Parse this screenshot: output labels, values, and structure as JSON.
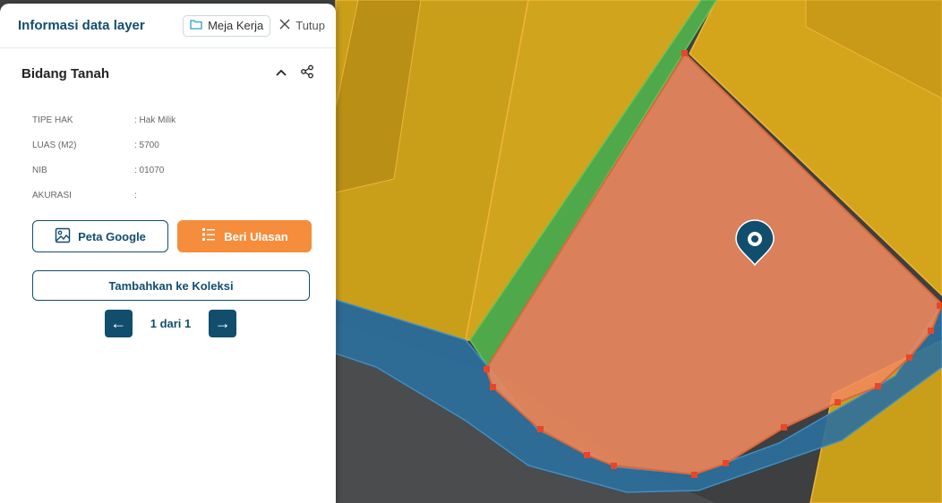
{
  "panel": {
    "title": "Informasi data layer",
    "workspace_label": "Meja Kerja",
    "close_label": "Tutup"
  },
  "section": {
    "title": "Bidang Tanah"
  },
  "attributes": [
    {
      "key": "TIPE HAK",
      "value": ": Hak Milik"
    },
    {
      "key": "LUAS (M2)",
      "value": ": 5700"
    },
    {
      "key": "NIB",
      "value": ": 01070"
    },
    {
      "key": "AKURASI",
      "value": ":"
    }
  ],
  "actions": {
    "google_map_label": "Peta Google",
    "review_label": "Beri Ulasan",
    "add_collection_label": "Tambahkan ke Koleksi"
  },
  "pagination": {
    "text": "1 dari 1",
    "prev_symbol": "←",
    "next_symbol": "→"
  },
  "colors": {
    "primary": "#114e6e",
    "accent_orange": "#f58d3d",
    "parcel_selected": "#f08a5d",
    "parcel_other": "#e0a818",
    "green_strip": "#4caf50",
    "water_blue": "#2a6f9b"
  },
  "icons": [
    "folder-icon",
    "close-icon",
    "chevron-up-icon",
    "share-icon",
    "image-icon",
    "review-icon",
    "map-pin-icon",
    "arrow-left-icon",
    "arrow-right-icon"
  ]
}
